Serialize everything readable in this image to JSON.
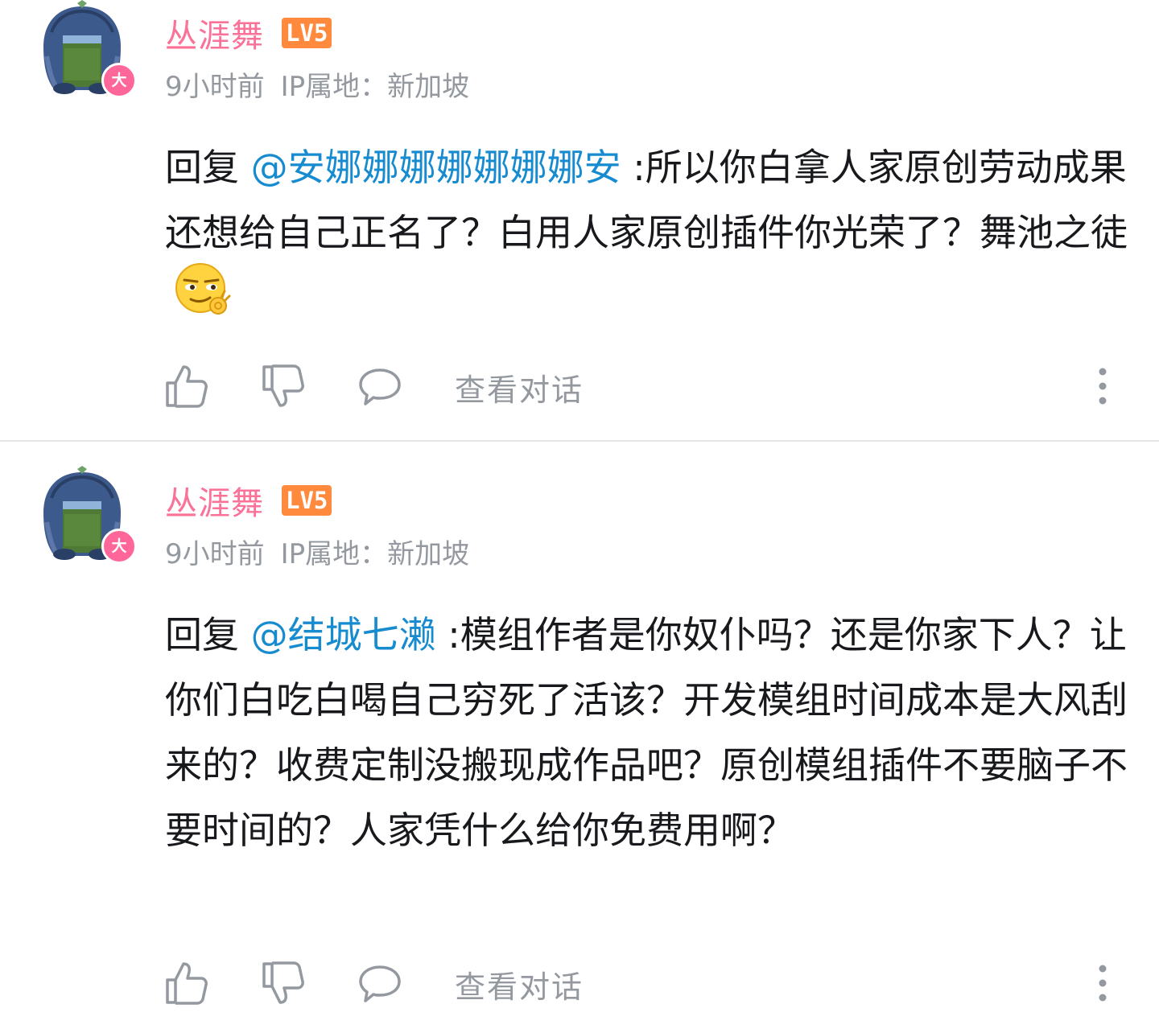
{
  "comments": [
    {
      "username": "丛涯舞",
      "level": "LV5",
      "avatar_badge": "大",
      "time": "9小时前",
      "ip": "IP属地：新加坡",
      "reply_prefix": "回复 ",
      "mention": "@安娜娜娜娜娜娜娜安",
      "content": " :所以你白拿人家原创劳动成果还想给自己正名了？白用人家原创插件你光荣了？舞池之徒",
      "emoji": "smirk-ok-emoji",
      "view_thread": "查看对话"
    },
    {
      "username": "丛涯舞",
      "level": "LV5",
      "avatar_badge": "大",
      "time": "9小时前",
      "ip": "IP属地：新加坡",
      "reply_prefix": "回复 ",
      "mention": "@结城七濑",
      "content": " :模组作者是你奴仆吗？还是你家下人？让你们白吃白喝自己穷死了活该？开发模组时间成本是大风刮来的？收费定制没搬现成作品吧？原创模组插件不要脑子不要时间的？人家凭什么给你免费用啊？",
      "view_thread": "查看对话"
    }
  ],
  "icons": {
    "like": "thumbs-up-icon",
    "dislike": "thumbs-down-icon",
    "reply": "comment-bubble-icon",
    "more": "more-vertical-icon"
  },
  "colors": {
    "username": "#fb7299",
    "level_badge": "#ff8a3d",
    "mention": "#178bcf",
    "meta": "#9499a0",
    "avatar_badge": "#ff6699"
  }
}
